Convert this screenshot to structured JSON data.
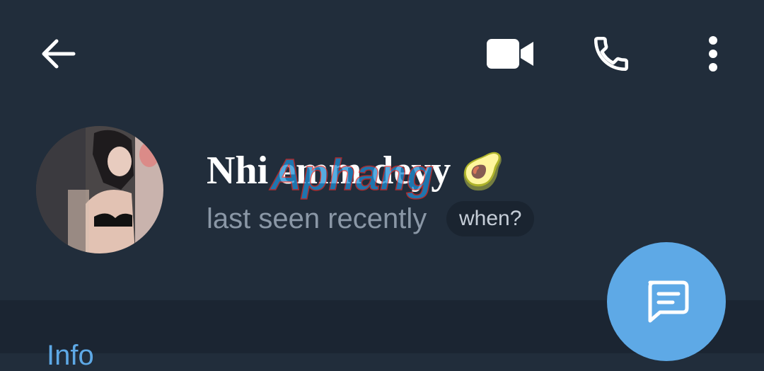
{
  "header": {
    "back_icon": "arrow-left-icon",
    "video_icon": "video-camera-icon",
    "call_icon": "phone-icon",
    "more_icon": "more-vertical-icon"
  },
  "profile": {
    "name": "Nhi emm deyy",
    "name_emoji": "🥑",
    "status": "last seen recently",
    "when_button": "when?"
  },
  "watermark_text": "Aphang",
  "section": {
    "info_label": "Info"
  },
  "fab": {
    "icon": "message-icon"
  },
  "colors": {
    "background": "#212d3b",
    "accent": "#5ea9e6",
    "status_text": "#8a97a6"
  }
}
